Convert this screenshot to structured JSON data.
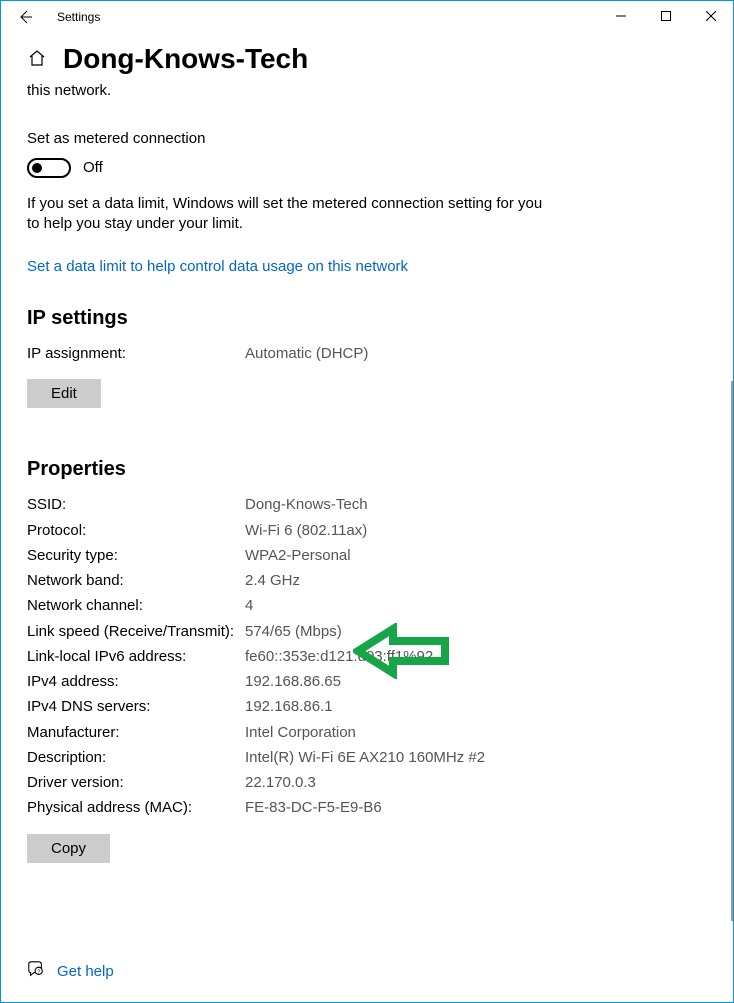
{
  "window": {
    "title": "Settings"
  },
  "page": {
    "heading": "Dong-Knows-Tech",
    "sub": "this network."
  },
  "metered": {
    "label": "Set as metered connection",
    "state": "Off",
    "desc": "If you set a data limit, Windows will set the metered connection setting for you to help you stay under your limit.",
    "link": "Set a data limit to help control data usage on this network"
  },
  "ip": {
    "heading": "IP settings",
    "assign_label": "IP assignment:",
    "assign_value": "Automatic (DHCP)",
    "edit": "Edit"
  },
  "props": {
    "heading": "Properties",
    "rows": {
      "ssid_k": "SSID:",
      "ssid_v": "Dong-Knows-Tech",
      "proto_k": "Protocol:",
      "proto_v": "Wi-Fi 6 (802.11ax)",
      "sec_k": "Security type:",
      "sec_v": "WPA2-Personal",
      "band_k": "Network band:",
      "band_v": "2.4 GHz",
      "chan_k": "Network channel:",
      "chan_v": "4",
      "speed_k": "Link speed (Receive/Transmit):",
      "speed_v": "574/65 (Mbps)",
      "ipv6_k": "Link-local IPv6 address:",
      "ipv6_v": "fe60::353e:d121:d03:ff1%92",
      "ipv4_k": "IPv4 address:",
      "ipv4_v": "192.168.86.65",
      "dns_k": "IPv4 DNS servers:",
      "dns_v": "192.168.86.1",
      "mfr_k": "Manufacturer:",
      "mfr_v": "Intel Corporation",
      "desc_k": "Description:",
      "desc_v": "Intel(R) Wi-Fi 6E AX210 160MHz #2",
      "drv_k": "Driver version:",
      "drv_v": "22.170.0.3",
      "mac_k": "Physical address (MAC):",
      "mac_v": "FE-83-DC-F5-E9-B6"
    },
    "copy": "Copy"
  },
  "help": {
    "label": "Get help"
  }
}
